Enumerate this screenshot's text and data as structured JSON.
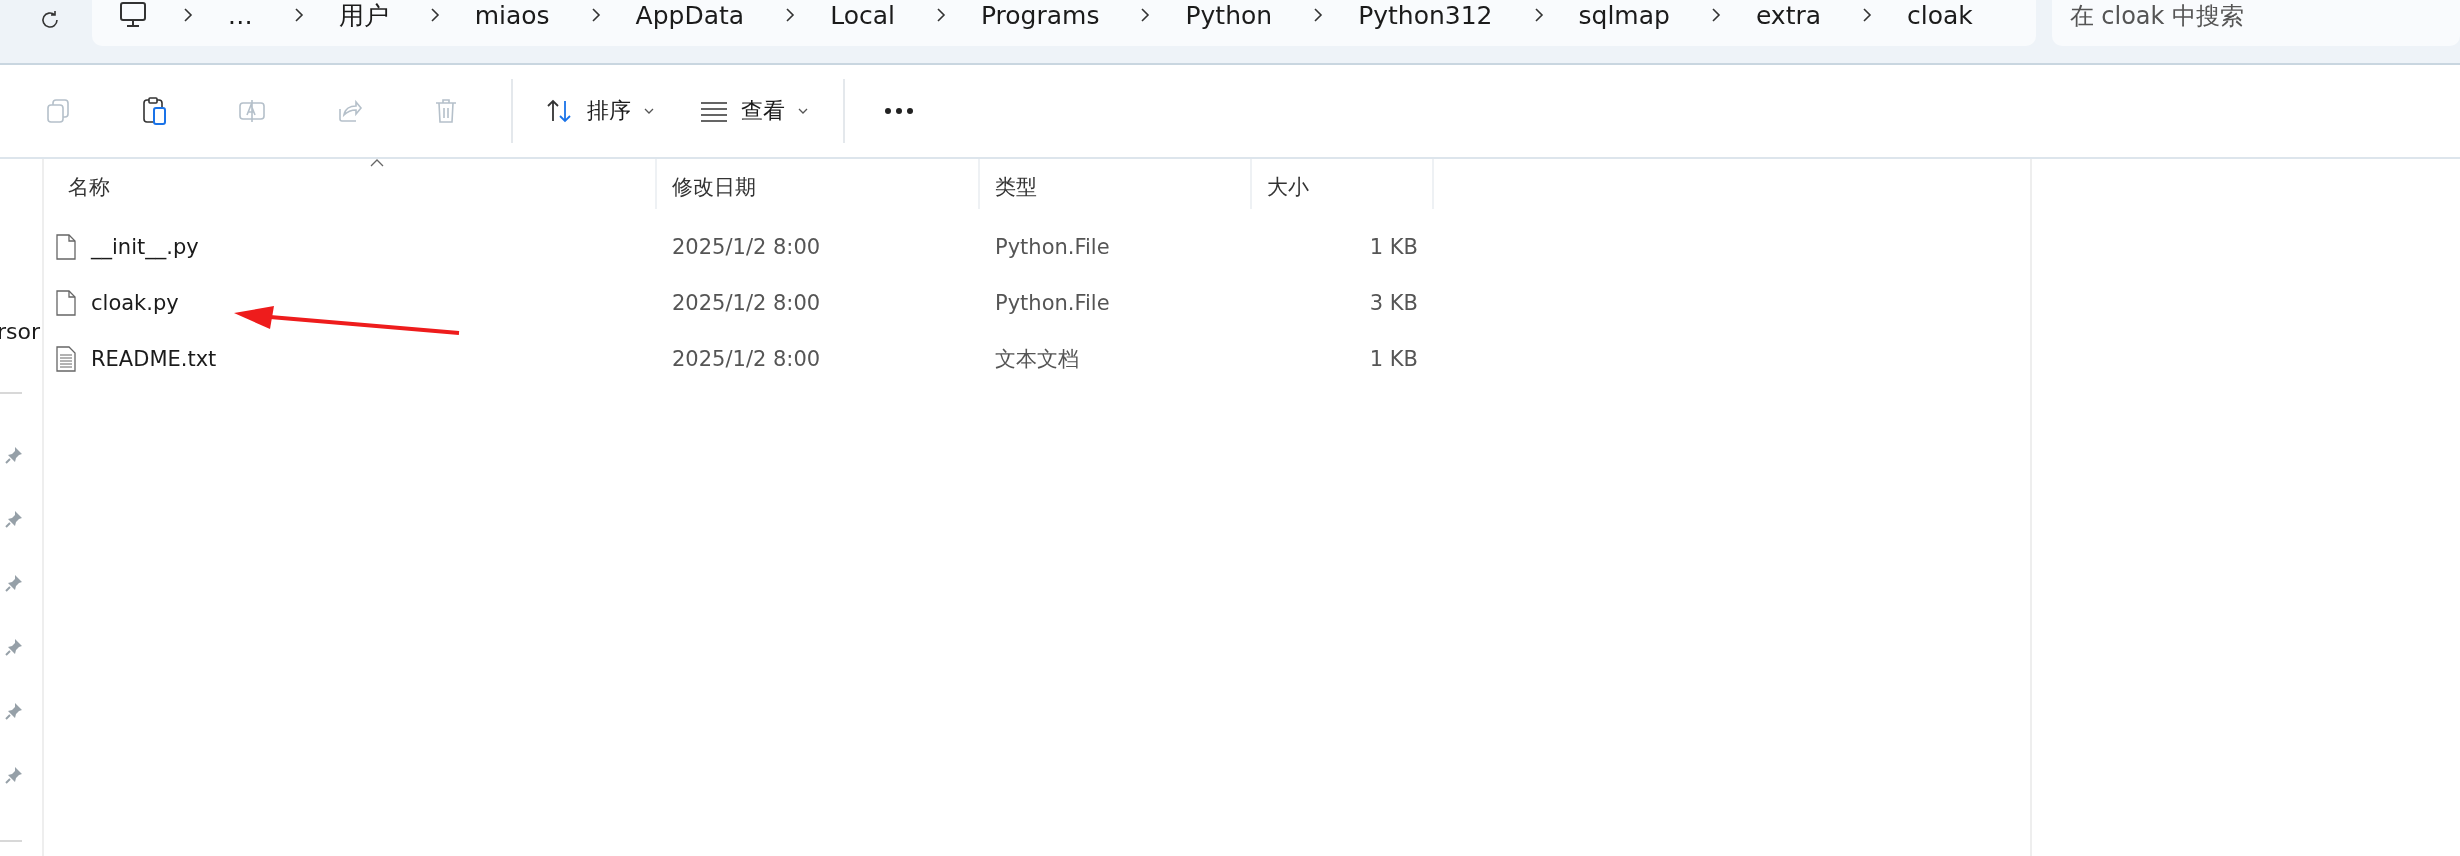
{
  "address_bar": {
    "overflow": "…",
    "crumbs": [
      "用户",
      "miaos",
      "AppData",
      "Local",
      "Programs",
      "Python",
      "Python312",
      "sqlmap",
      "extra",
      "cloak"
    ]
  },
  "search": {
    "placeholder": "在 cloak 中搜索"
  },
  "toolbar": {
    "actions": [
      {
        "kind": "copy",
        "disabled": true
      },
      {
        "kind": "paste",
        "disabled": false
      },
      {
        "kind": "rename",
        "disabled": true
      },
      {
        "kind": "share",
        "disabled": true
      },
      {
        "kind": "delete",
        "disabled": true
      }
    ],
    "sort_label": "排序",
    "view_label": "查看"
  },
  "sidebar": {
    "partial_label": "rsor",
    "items": [
      {
        "pinned": true
      },
      {
        "pinned": true
      },
      {
        "pinned": true
      },
      {
        "pinned": true
      },
      {
        "pinned": true
      },
      {
        "pinned": true
      }
    ]
  },
  "columns": [
    {
      "label": "名称",
      "sorted": true
    },
    {
      "label": "修改日期",
      "sorted": false
    },
    {
      "label": "类型",
      "sorted": false
    },
    {
      "label": "大小",
      "sorted": false
    }
  ],
  "rows": [
    {
      "kind": "code",
      "name": "__init__.py",
      "modified": "2025/1/2 8:00",
      "type": "Python.File",
      "size": "1 KB",
      "annotated": false
    },
    {
      "kind": "code",
      "name": "cloak.py",
      "modified": "2025/1/2 8:00",
      "type": "Python.File",
      "size": "3 KB",
      "annotated": true
    },
    {
      "kind": "text",
      "name": "README.txt",
      "modified": "2025/1/2 8:00",
      "type": "文本文档",
      "size": "1 KB",
      "annotated": false
    }
  ]
}
